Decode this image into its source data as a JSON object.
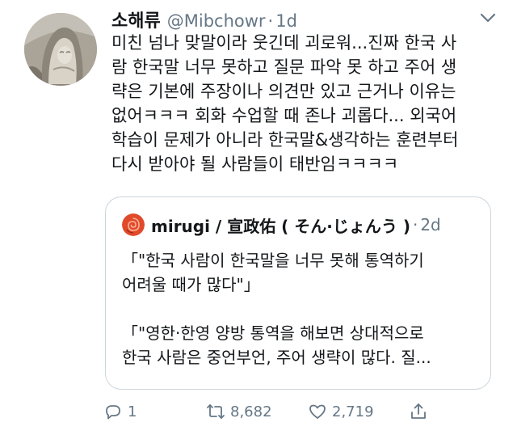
{
  "tweet": {
    "display_name": "소해류",
    "handle": "@Mibchowr",
    "separator": "·",
    "time": "1d",
    "text_lines": [
      "미친 넘나 맞말이라 웃긴데 괴로워...진짜 한국 사",
      "람 한국말 너무 못하고 질문 파악 못 하고 주어 생",
      "략은 기본에 주장이나 의견만 있고 근거나 이유는",
      "없어ㅋㅋㅋ 회화 수업할 때 존나 괴롭다... 외국어",
      "학습이 문제가 아니라 한국말&생각하는 훈련부터",
      "다시 받아야 될 사람들이 태반임ㅋㅋㅋㅋ"
    ]
  },
  "quoted": {
    "display_name": "mirugi / 宣政佑 ( そん·じょんう )",
    "separator": "·",
    "time": "2d",
    "lines_1": [
      "「\"한국 사람이 한국말을 너무 못해 통역하기",
      "어려울 때가 많다\"」"
    ],
    "lines_2": [
      "「\"영한·한영 양방 통역을 해보면 상대적으로",
      "한국 사람은 중언부언, 주어 생략이 많다. 질..."
    ]
  },
  "actions": {
    "reply_count": "1",
    "retweet_count": "8,682",
    "like_count": "2,719"
  },
  "colors": {
    "text": "#14171a",
    "secondary": "#657786",
    "border": "#ccd6dd",
    "background": "#ffffff"
  }
}
